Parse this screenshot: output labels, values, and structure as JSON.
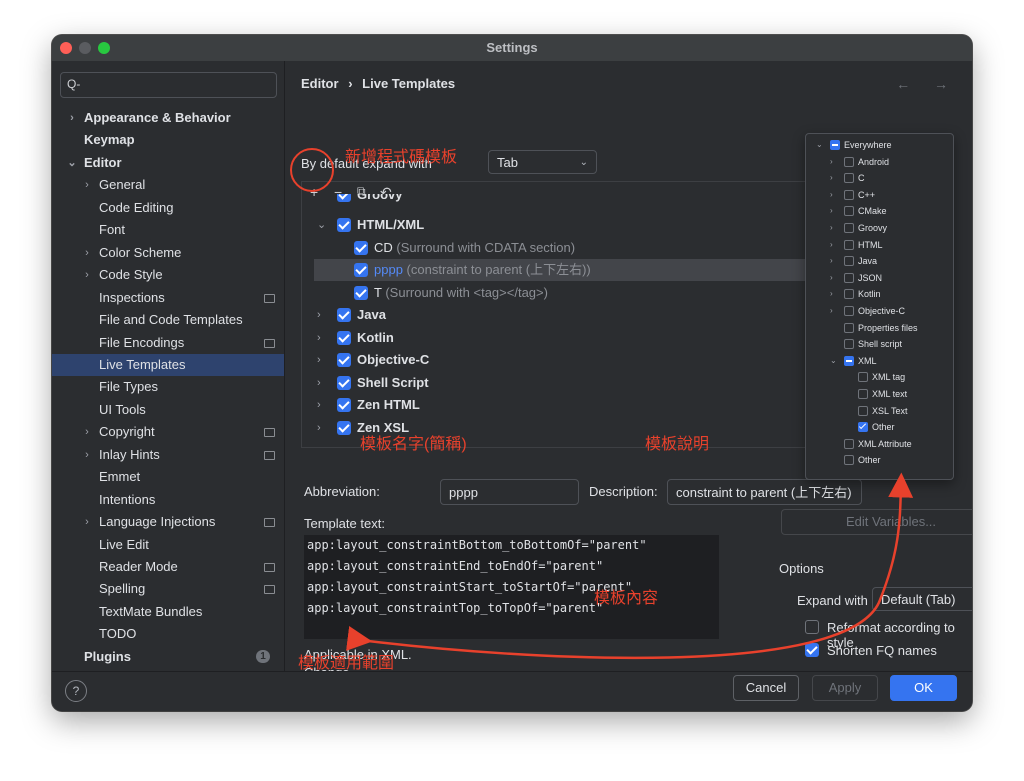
{
  "window": {
    "title": "Settings"
  },
  "sidebar": {
    "search_placeholder": "Q-",
    "items": [
      {
        "label": "Appearance & Behavior",
        "level": 0,
        "arrow": "›",
        "bold": true
      },
      {
        "label": "Keymap",
        "level": 0,
        "bold": true
      },
      {
        "label": "Editor",
        "level": 0,
        "arrow": "⌄",
        "bold": true
      },
      {
        "label": "General",
        "level": 1,
        "arrow": "›"
      },
      {
        "label": "Code Editing",
        "level": 1
      },
      {
        "label": "Font",
        "level": 1
      },
      {
        "label": "Color Scheme",
        "level": 1,
        "arrow": "›"
      },
      {
        "label": "Code Style",
        "level": 1,
        "arrow": "›"
      },
      {
        "label": "Inspections",
        "level": 1,
        "mini": true
      },
      {
        "label": "File and Code Templates",
        "level": 1
      },
      {
        "label": "File Encodings",
        "level": 1,
        "mini": true
      },
      {
        "label": "Live Templates",
        "level": 1,
        "selected": true
      },
      {
        "label": "File Types",
        "level": 1
      },
      {
        "label": "UI Tools",
        "level": 1
      },
      {
        "label": "Copyright",
        "level": 1,
        "arrow": "›",
        "mini": true
      },
      {
        "label": "Inlay Hints",
        "level": 1,
        "arrow": "›",
        "mini": true
      },
      {
        "label": "Emmet",
        "level": 1
      },
      {
        "label": "Intentions",
        "level": 1
      },
      {
        "label": "Language Injections",
        "level": 1,
        "arrow": "›",
        "mini": true
      },
      {
        "label": "Live Edit",
        "level": 1
      },
      {
        "label": "Reader Mode",
        "level": 1,
        "mini": true
      },
      {
        "label": "Spelling",
        "level": 1,
        "mini": true
      },
      {
        "label": "TextMate Bundles",
        "level": 1
      },
      {
        "label": "TODO",
        "level": 1
      },
      {
        "label": "Plugins",
        "level": 0,
        "bold": true,
        "badge": "1"
      }
    ]
  },
  "header": {
    "breadcrumb_root": "Editor",
    "breadcrumb_sep": "›",
    "breadcrumb_leaf": "Live Templates",
    "nav": "← →"
  },
  "expand": {
    "label": "By default expand with",
    "value": "Tab"
  },
  "toolbar": {
    "add": "+",
    "remove": "−",
    "copy": "⧉",
    "undo": "↶"
  },
  "template_groups": {
    "groovy": "Groovy",
    "html_xml": "HTML/XML",
    "items": [
      {
        "abbr": "CD",
        "desc": "(Surround with CDATA section)"
      },
      {
        "abbr": "pppp",
        "desc": "(constraint to parent (上下左右))"
      },
      {
        "abbr": "T",
        "desc": "(Surround with <tag></tag>)"
      }
    ],
    "rest": [
      "Java",
      "Kotlin",
      "Objective-C",
      "Shell Script",
      "Zen HTML",
      "Zen XSL"
    ]
  },
  "form": {
    "abbreviation_label": "Abbreviation:",
    "abbreviation_value": "pppp",
    "description_label": "Description:",
    "description_value": "constraint to parent (上下左右)",
    "template_text_label": "Template text:",
    "template_lines": [
      "app:layout_constraintBottom_toBottomOf=\"parent\"",
      "app:layout_constraintEnd_toEndOf=\"parent\"",
      "app:layout_constraintStart_toStartOf=\"parent\"",
      "app:layout_constraintTop_toTopOf=\"parent\""
    ],
    "applicable_text": "Applicable in XML.",
    "change_link": "Change ⌄",
    "edit_variables": "Edit Variables...",
    "options_label": "Options",
    "expand_with_label": "Expand with",
    "expand_with_value": "Default (Tab)",
    "reformat_label": "Reformat according to style",
    "shorten_label": "Shorten FQ names"
  },
  "buttons": {
    "help": "?",
    "cancel": "Cancel",
    "apply": "Apply",
    "ok": "OK"
  },
  "context_popup": [
    {
      "label": "Everywhere",
      "arrow": "⌄",
      "state": "mixed",
      "indent": 0
    },
    {
      "label": "Android",
      "arrow": "›",
      "state": "off",
      "indent": 1
    },
    {
      "label": "C",
      "arrow": "›",
      "state": "off",
      "indent": 1
    },
    {
      "label": "C++",
      "arrow": "›",
      "state": "off",
      "indent": 1
    },
    {
      "label": "CMake",
      "arrow": "›",
      "state": "off",
      "indent": 1
    },
    {
      "label": "Groovy",
      "arrow": "›",
      "state": "off",
      "indent": 1
    },
    {
      "label": "HTML",
      "arrow": "›",
      "state": "off",
      "indent": 1
    },
    {
      "label": "Java",
      "arrow": "›",
      "state": "off",
      "indent": 1
    },
    {
      "label": "JSON",
      "arrow": "›",
      "state": "off",
      "indent": 1
    },
    {
      "label": "Kotlin",
      "arrow": "›",
      "state": "off",
      "indent": 1
    },
    {
      "label": "Objective-C",
      "arrow": "›",
      "state": "off",
      "indent": 1
    },
    {
      "label": "Properties files",
      "arrow": "",
      "state": "off",
      "indent": 1
    },
    {
      "label": "Shell script",
      "arrow": "",
      "state": "off",
      "indent": 1
    },
    {
      "label": "XML",
      "arrow": "⌄",
      "state": "mixed",
      "indent": 1
    },
    {
      "label": "XML tag",
      "arrow": "",
      "state": "off",
      "indent": 2
    },
    {
      "label": "XML text",
      "arrow": "",
      "state": "off",
      "indent": 2
    },
    {
      "label": "XSL Text",
      "arrow": "",
      "state": "off",
      "indent": 2
    },
    {
      "label": "Other",
      "arrow": "",
      "state": "on",
      "indent": 2
    },
    {
      "label": "XML Attribute",
      "arrow": "",
      "state": "off",
      "indent": 1
    },
    {
      "label": "Other",
      "arrow": "",
      "state": "off",
      "indent": 1
    }
  ],
  "annotations": {
    "add_template": "新增程式碼模板",
    "template_name": "模板名字(簡稱)",
    "template_desc": "模板說明",
    "template_content": "模板內容",
    "template_scope": "模板適用範圍",
    "color": "#e8412c"
  }
}
